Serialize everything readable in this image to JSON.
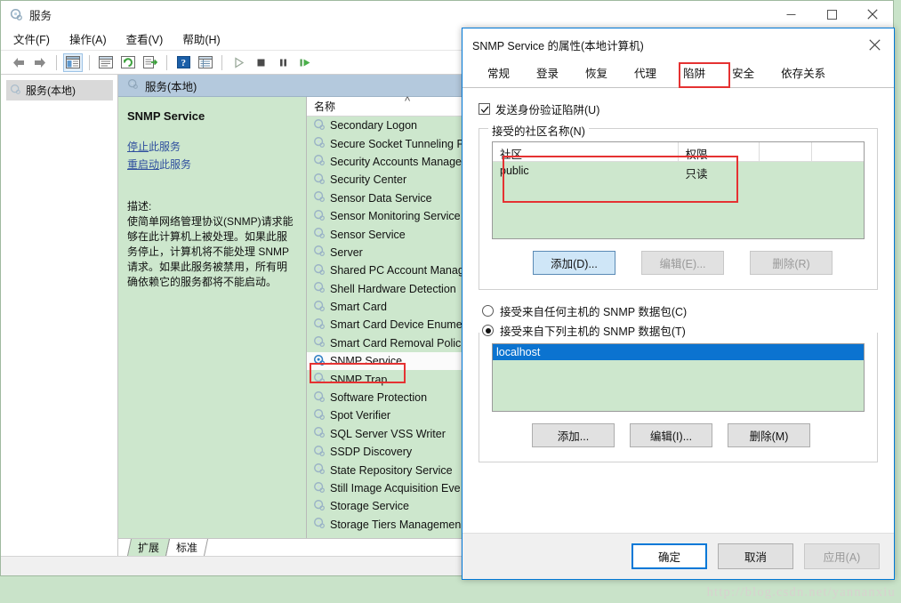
{
  "window": {
    "title": "服务",
    "icon": "services-gear-icon",
    "controls": {
      "minimize": "minimize-icon",
      "maximize": "maximize-icon",
      "close": "close-icon"
    },
    "menus": [
      "文件(F)",
      "操作(A)",
      "查看(V)",
      "帮助(H)"
    ],
    "toolbar_icons": [
      "back-arrow-icon",
      "forward-arrow-icon",
      "show-hide-tree-icon",
      "properties-icon",
      "refresh-icon",
      "export-list-icon",
      "help-icon",
      "show-list-icon",
      "start-service-icon",
      "stop-service-icon",
      "pause-service-icon",
      "restart-service-icon"
    ],
    "tree": {
      "root_label": "服务(本地)",
      "icon": "services-gear-icon"
    },
    "pane_header": {
      "label": "服务(本地)",
      "icon": "services-gear-icon"
    },
    "bottom_tabs": [
      {
        "label": "扩展",
        "active": true
      },
      {
        "label": "标准",
        "active": false
      }
    ]
  },
  "detail": {
    "service_name": "SNMP Service",
    "link_stop_prefix": "停止",
    "link_stop_suffix": "此服务",
    "link_restart_prefix": "重启动",
    "link_restart_suffix": "此服务",
    "desc_label": "描述:",
    "desc_text": "使简单网络管理协议(SNMP)请求能够在此计算机上被处理。如果此服务停止，计算机将不能处理 SNMP 请求。如果此服务被禁用，所有明确依赖它的服务都将不能启动。"
  },
  "list": {
    "column_header": "名称",
    "sort_indicator": "^",
    "rows": [
      {
        "name": "Secondary Logon",
        "selected": false
      },
      {
        "name": "Secure Socket Tunneling P",
        "selected": false
      },
      {
        "name": "Security Accounts Manage",
        "selected": false
      },
      {
        "name": "Security Center",
        "selected": false
      },
      {
        "name": "Sensor Data Service",
        "selected": false
      },
      {
        "name": "Sensor Monitoring Service",
        "selected": false
      },
      {
        "name": "Sensor Service",
        "selected": false
      },
      {
        "name": "Server",
        "selected": false
      },
      {
        "name": "Shared PC Account Manag",
        "selected": false
      },
      {
        "name": "Shell Hardware Detection",
        "selected": false
      },
      {
        "name": "Smart Card",
        "selected": false
      },
      {
        "name": "Smart Card Device Enume",
        "selected": false
      },
      {
        "name": "Smart Card Removal Polic",
        "selected": false
      },
      {
        "name": "SNMP Service",
        "selected": true
      },
      {
        "name": "SNMP Trap",
        "selected": false
      },
      {
        "name": "Software Protection",
        "selected": false
      },
      {
        "name": "Spot Verifier",
        "selected": false
      },
      {
        "name": "SQL Server VSS Writer",
        "selected": false
      },
      {
        "name": "SSDP Discovery",
        "selected": false
      },
      {
        "name": "State Repository Service",
        "selected": false
      },
      {
        "name": "Still Image Acquisition Eve",
        "selected": false
      },
      {
        "name": "Storage Service",
        "selected": false
      },
      {
        "name": "Storage Tiers Managemen",
        "selected": false
      }
    ]
  },
  "dialog": {
    "title": "SNMP Service 的属性(本地计算机)",
    "close_icon": "close-icon",
    "tabs": [
      {
        "label": "常规",
        "active": false
      },
      {
        "label": "登录",
        "active": false
      },
      {
        "label": "恢复",
        "active": false
      },
      {
        "label": "代理",
        "active": false
      },
      {
        "label": "陷阱",
        "active": false
      },
      {
        "label": "安全",
        "active": true
      },
      {
        "label": "依存关系",
        "active": false
      }
    ],
    "auth_trap": {
      "label": "发送身份验证陷阱(U)",
      "checked": true
    },
    "community": {
      "legend": "接受的社区名称(N)",
      "columns": [
        "社区",
        "权限",
        "",
        ""
      ],
      "rows": [
        {
          "community": "public",
          "rights": "只读"
        }
      ],
      "buttons": [
        {
          "label": "添加(D)...",
          "state": "focused"
        },
        {
          "label": "编辑(E)...",
          "state": "disabled"
        },
        {
          "label": "删除(R)",
          "state": "disabled"
        }
      ]
    },
    "hosts": {
      "radio_any": {
        "label": "接受来自任何主机的 SNMP 数据包(C)",
        "selected": false
      },
      "radio_list": {
        "label": "接受来自下列主机的 SNMP 数据包(T)",
        "selected": true
      },
      "entries": [
        {
          "host": "localhost",
          "selected": true
        }
      ],
      "buttons": [
        {
          "label": "添加...",
          "state": "normal"
        },
        {
          "label": "编辑(I)...",
          "state": "normal"
        },
        {
          "label": "删除(M)",
          "state": "normal"
        }
      ]
    },
    "footer_buttons": [
      {
        "label": "确定",
        "state": "default"
      },
      {
        "label": "取消",
        "state": "normal"
      },
      {
        "label": "应用(A)",
        "state": "disabled"
      }
    ]
  },
  "watermark": {
    "text": "http://blog.csdn.net/yannanxiu"
  },
  "colors": {
    "green_bg": "#cde7cd",
    "accent_blue": "#0078d7",
    "selection_blue": "#0b73d0",
    "annotation_red": "#e53232",
    "pane_header_blue": "#b4c9dd"
  }
}
